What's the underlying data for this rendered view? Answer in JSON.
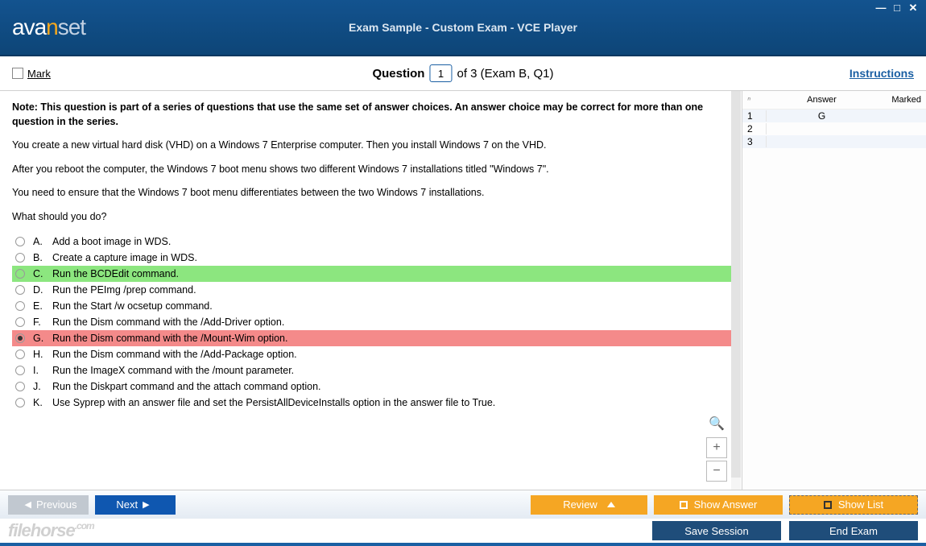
{
  "header": {
    "logo_first": "ava",
    "logo_n": "n",
    "logo_rest": "set",
    "title": "Exam Sample - Custom Exam - VCE Player"
  },
  "subbar": {
    "mark_label": "Mark",
    "question_label": "Question",
    "question_num": "1",
    "of_text": "of 3 (Exam B, Q1)",
    "instructions": "Instructions"
  },
  "question": {
    "note": "Note: This question is part of a series of questions that use the same set of answer choices. An answer choice may be correct for more than one question in the series.",
    "p1": "You create a new virtual hard disk (VHD) on a Windows 7 Enterprise computer. Then you install Windows 7 on the VHD.",
    "p2": "After you reboot the computer, the Windows 7 boot menu shows two different Windows 7 installations titled \"Windows 7\".",
    "p3": "You need to ensure that the Windows 7 boot menu differentiates between the two Windows 7 installations.",
    "p4": "What should you do?"
  },
  "choices": [
    {
      "letter": "A.",
      "text": "Add a boot image in WDS.",
      "state": ""
    },
    {
      "letter": "B.",
      "text": "Create a capture image in WDS.",
      "state": ""
    },
    {
      "letter": "C.",
      "text": "Run the BCDEdit command.",
      "state": "correct"
    },
    {
      "letter": "D.",
      "text": "Run the PEImg /prep command.",
      "state": ""
    },
    {
      "letter": "E.",
      "text": "Run the Start /w ocsetup command.",
      "state": ""
    },
    {
      "letter": "F.",
      "text": "Run the Dism command with the /Add-Driver option.",
      "state": ""
    },
    {
      "letter": "G.",
      "text": "Run the Dism command with the /Mount-Wim option.",
      "state": "wrong"
    },
    {
      "letter": "H.",
      "text": "Run the Dism command with the /Add-Package option.",
      "state": ""
    },
    {
      "letter": "I.",
      "text": "Run the ImageX command with the /mount parameter.",
      "state": ""
    },
    {
      "letter": "J.",
      "text": "Run the Diskpart command and the attach command option.",
      "state": ""
    },
    {
      "letter": "K.",
      "text": "Use Syprep with an answer file and set the PersistAllDeviceInstalls option in the answer file to True.",
      "state": ""
    }
  ],
  "sidebar": {
    "num_head": "ⁿ",
    "answer_head": "Answer",
    "marked_head": "Marked",
    "rows": [
      {
        "n": "1",
        "a": "G",
        "m": ""
      },
      {
        "n": "2",
        "a": "",
        "m": ""
      },
      {
        "n": "3",
        "a": "",
        "m": ""
      }
    ]
  },
  "footer": {
    "previous": "Previous",
    "next": "Next",
    "review": "Review",
    "show_answer": "Show Answer",
    "show_list": "Show List",
    "save_session": "Save Session",
    "end_exam": "End Exam",
    "watermark_main": "filehorse",
    "watermark_ext": ".com"
  }
}
